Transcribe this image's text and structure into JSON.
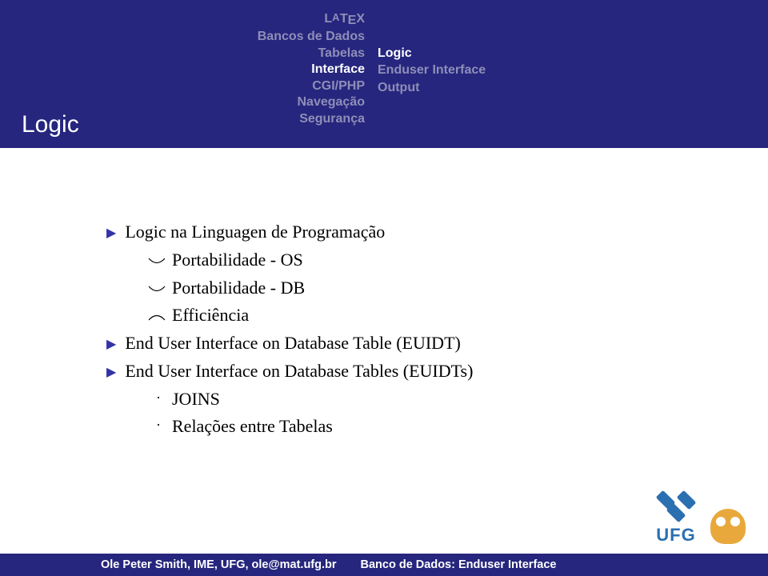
{
  "nav_left": {
    "item0a": "L",
    "item0b": "T",
    "item0c": "X",
    "item1": "Bancos de Dados",
    "item2": "Tabelas",
    "item3": "Interface",
    "item4": "CGI/PHP",
    "item5": "Navegação",
    "item6": "Segurança"
  },
  "nav_right": {
    "item0": "Logic",
    "item1": "Enduser Interface",
    "item2": "Output"
  },
  "title": "Logic",
  "bullets": {
    "b1": "Logic na Linguagen de Programação",
    "b1_s1": "Portabilidade - OS",
    "b1_s2": "Portabilidade - DB",
    "b1_s3": "Efficiência",
    "b2": "End User Interface on Database Table (EUIDT)",
    "b3": "End User Interface on Database Tables (EUIDTs)",
    "b3_s1": "JOINS",
    "b3_s2": "Relações entre Tabelas"
  },
  "footer": {
    "left": "Ole Peter Smith, IME, UFG, ole@mat.ufg.br",
    "right": "Banco de Dados: Enduser Interface"
  },
  "logo_text": "UFG"
}
